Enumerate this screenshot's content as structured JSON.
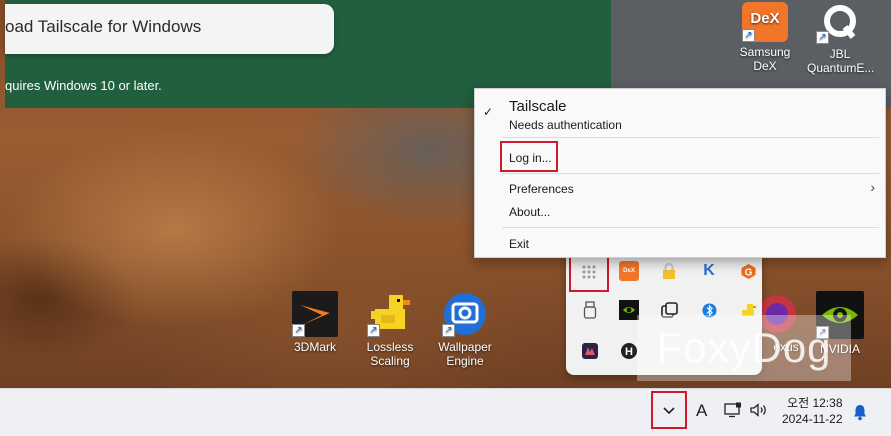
{
  "browser": {
    "download_title": "oad Tailscale for Windows",
    "requires_note": "quires Windows 10 or later."
  },
  "desktop_icons": [
    {
      "label": "Samsung DeX",
      "icon": "samsung-dex-icon",
      "badge": "DeX"
    },
    {
      "label": "JBL QuantumE...",
      "icon": "jbl-quantum-icon",
      "badge": "Q"
    },
    {
      "label": "3DMark",
      "icon": "3dmark-icon"
    },
    {
      "label": "Lossless Scaling",
      "icon": "lossless-scaling-duck-icon"
    },
    {
      "label": "Wallpaper Engine",
      "icon": "wallpaper-engine-icon"
    },
    {
      "label": "exus",
      "icon": "nexus-icon"
    },
    {
      "label": "NVIDIA",
      "icon": "nvidia-icon"
    }
  ],
  "tray_menu": {
    "title": "Tailscale",
    "subtitle": "Needs authentication",
    "check": "✓",
    "items": [
      "Log in...",
      "Preferences",
      "About...",
      "Exit"
    ],
    "submenu_chevron": "›"
  },
  "tray_overflow": {
    "icons": [
      "more-apps-grid-icon",
      "dex-tray-icon",
      "lock-tray-icon",
      "vpn-k-tray-icon",
      "g-hub-tray-icon",
      "usb-device-tray-icon",
      "nvidia-tray-icon",
      "tailscale-tray-icon",
      "bluetooth-tray-icon",
      "duck-tray-icon",
      "app-tray-icon",
      "h-app-tray-icon"
    ],
    "dex_badge": "DeX"
  },
  "taskbar": {
    "chevron": "⌄",
    "ime": "A",
    "clock_time": "오전 12:38",
    "clock_date": "2024-11-22"
  },
  "watermark": "FoxyDog",
  "colors": {
    "highlight": "#d0192a",
    "browser_green": "#215f3e",
    "taskbar": "#eef0f4"
  }
}
